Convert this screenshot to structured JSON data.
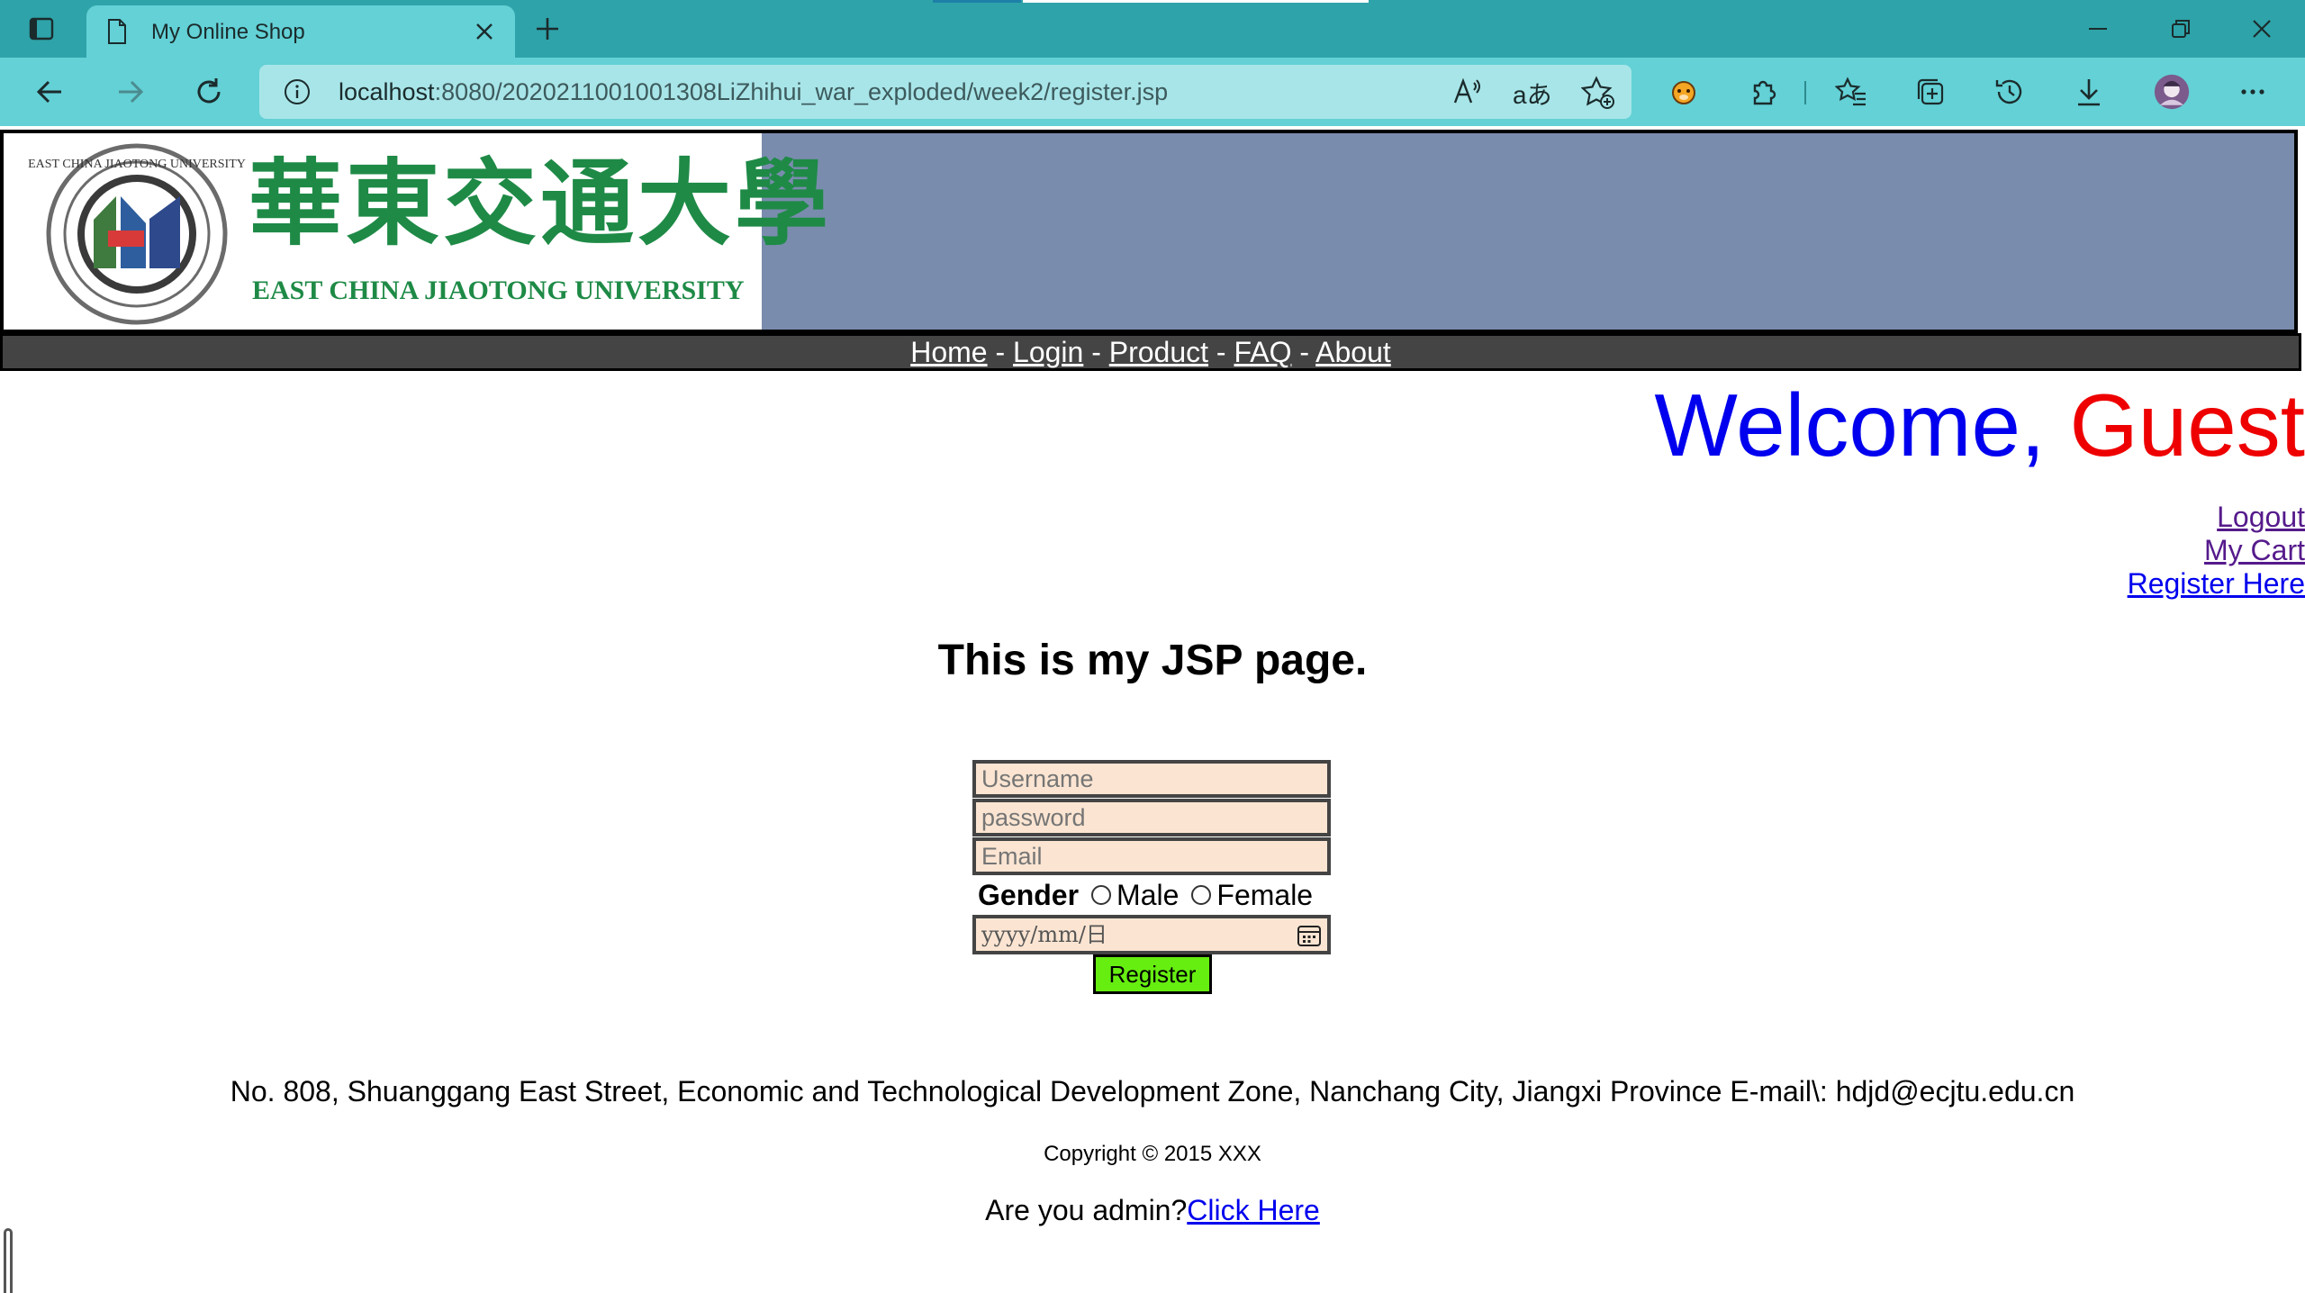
{
  "browser": {
    "tab_title": "My Online Shop",
    "url_host": "localhost",
    "url_rest": ":8080/2020211001001308LiZhihui_war_exploded/week2/register.jsp",
    "colors": {
      "tabbar": "#2ea3a9",
      "toolbar": "#63d1d6",
      "address": "#a8e5e8"
    }
  },
  "header": {
    "logo_cn": "華東交通大學",
    "logo_en": "EAST CHINA JIAOTONG UNIVERSITY",
    "seal_text": "EAST CHINA JIAOTONG UNIVERSITY"
  },
  "nav": {
    "items": [
      "Home",
      "Login",
      "Product",
      "FAQ",
      "About"
    ],
    "separator": " - "
  },
  "welcome": {
    "prefix": "Welcome, ",
    "name": "Guest"
  },
  "side_links": {
    "logout": "Logout",
    "cart": "My Cart",
    "register": "Register Here"
  },
  "main": {
    "heading": "This is my JSP page.",
    "form": {
      "username_placeholder": "Username",
      "password_placeholder": "password",
      "email_placeholder": "Email",
      "gender_label": "Gender",
      "gender_options": [
        "Male",
        "Female"
      ],
      "date_placeholder": "yyyy/mm/日",
      "submit_label": "Register"
    }
  },
  "footer": {
    "address": "No. 808, Shuanggang East Street, Economic and Technological Development Zone, Nanchang City, Jiangxi Province E-mail\\: hdjd@ecjtu.edu.cn",
    "copyright": "Copyright © 2015 XXX",
    "admin_text": "Are you admin?",
    "admin_link": "Click Here"
  }
}
